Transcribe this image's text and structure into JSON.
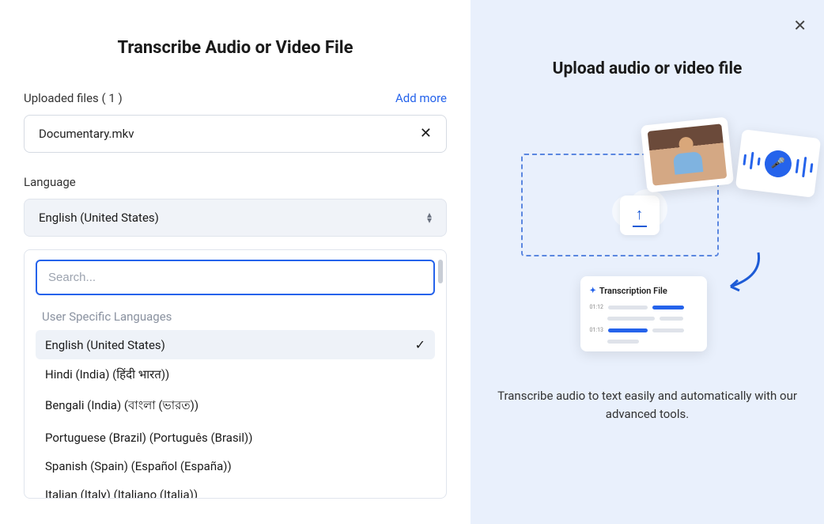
{
  "title": "Transcribe Audio or Video File",
  "uploaded_label": "Uploaded files ( 1 )",
  "add_more": "Add more",
  "file": {
    "name": "Documentary.mkv"
  },
  "language_label": "Language",
  "selected_language": "English (United States)",
  "search_placeholder": "Search...",
  "group_label": "User Specific Languages",
  "languages": [
    {
      "label": "English (United States)",
      "selected": true
    },
    {
      "label": "Hindi (India) (हिंदी भारत))",
      "selected": false
    },
    {
      "label": "Bengali (India) (বাংলা (ভারত))",
      "selected": false
    },
    {
      "label": "Portuguese (Brazil) (Português (Brasil))",
      "selected": false
    },
    {
      "label": "Spanish (Spain) (Español (España))",
      "selected": false
    },
    {
      "label": "Italian (Italy) (Italiano (Italia))",
      "selected": false
    }
  ],
  "right": {
    "title": "Upload audio or video file",
    "card_title": "Transcription File",
    "t1": "01:12",
    "t2": "01:13",
    "desc": "Transcribe audio to text easily and automatically with our advanced tools."
  }
}
